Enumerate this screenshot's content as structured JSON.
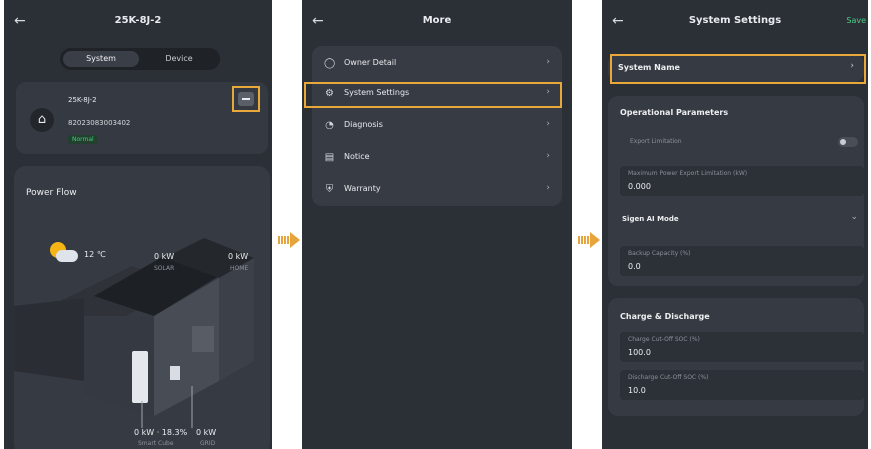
{
  "screen1": {
    "title": "25K-8J-2",
    "tabs": [
      "System",
      "Device"
    ],
    "system_name": "25K-8J-2",
    "serial": "82023083003402",
    "status": "Normal",
    "power_flow_title": "Power Flow",
    "weather_temp": "12 ℃",
    "solar_value": "0 kW",
    "solar_label": "SOLAR",
    "home_value": "0 kW",
    "home_label": "HOME",
    "battery_value": "0 kW · 18.3%",
    "battery_label": "Smart Cube",
    "grid_value": "0 kW",
    "grid_label": "GRID"
  },
  "screen2": {
    "title": "More",
    "items": [
      {
        "label": "Owner Detail",
        "icon": "user-icon"
      },
      {
        "label": "System Settings",
        "icon": "gear-icon"
      },
      {
        "label": "Diagnosis",
        "icon": "diagnosis-icon"
      },
      {
        "label": "Notice",
        "icon": "notice-icon"
      },
      {
        "label": "Warranty",
        "icon": "shield-icon"
      }
    ]
  },
  "screen3": {
    "title": "System Settings",
    "save": "Save",
    "system_name_label": "System Name",
    "operational_title": "Operational Parameters",
    "export_limitation_label": "Export Limitation",
    "max_export_label": "Maximum Power Export Limitation (kW)",
    "max_export_value": "0.000",
    "sigen_ai_label": "Sigen AI Mode",
    "backup_label": "Backup Capacity (%)",
    "backup_value": "0.0",
    "charge_title": "Charge & Discharge",
    "charge_cutoff_label": "Charge Cut-Off SOC (%)",
    "charge_cutoff_value": "100.0",
    "discharge_cutoff_label": "Discharge Cut-Off SOC (%)",
    "discharge_cutoff_value": "10.0"
  },
  "colors": {
    "panel_bg": "#2b2f36",
    "card_bg": "#363a42",
    "highlight": "#e8a93a",
    "status_green": "#3fcf7d",
    "save_green": "#4ad08a"
  }
}
